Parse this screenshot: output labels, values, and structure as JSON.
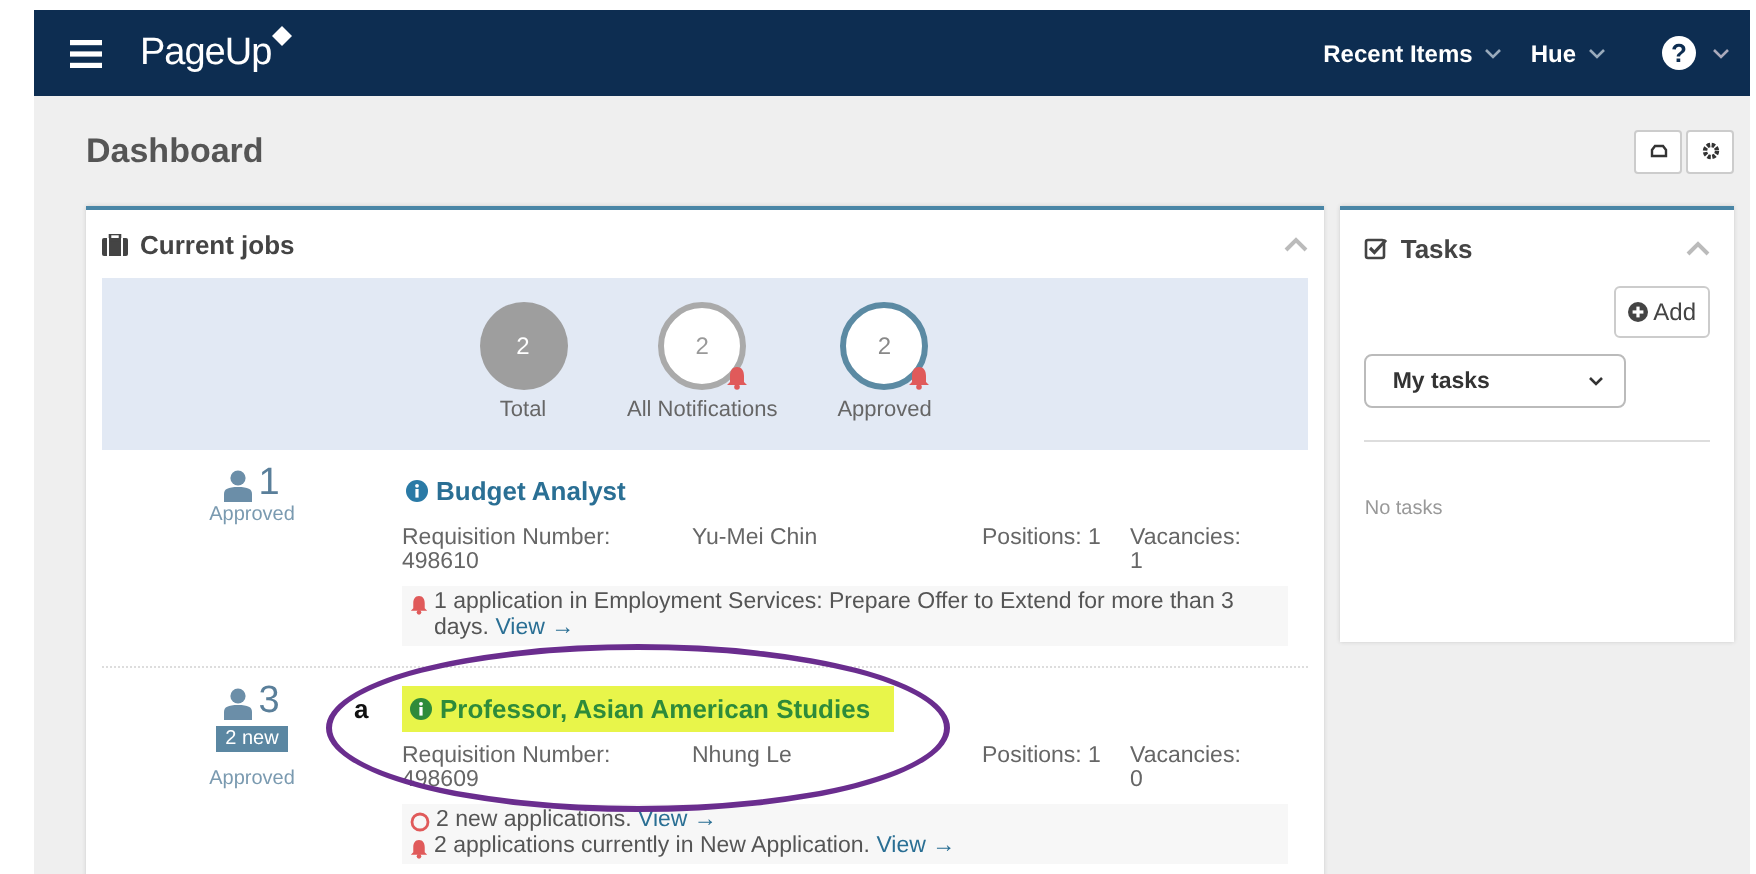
{
  "navbar": {
    "logo": "PageUp",
    "menus": [
      {
        "label": "Recent Items"
      },
      {
        "label": "Hue"
      }
    ],
    "help": "?"
  },
  "page_title": "Dashboard",
  "current_jobs": {
    "title": "Current jobs",
    "summary": [
      {
        "kind": "filled",
        "count": "2",
        "label": "Total",
        "alert": false
      },
      {
        "kind": "ring",
        "count": "2",
        "label": "All Notifications",
        "alert": true
      },
      {
        "kind": "ring-blue",
        "count": "2",
        "label": "Approved",
        "alert": true
      }
    ],
    "jobs": [
      {
        "count": "1",
        "status": "Approved",
        "title": "Budget Analyst",
        "highlighted": false,
        "requisition_label": "Requisition Number:",
        "requisition": "498610",
        "manager": "Yu-Mei Chin",
        "positions": "Positions: 1",
        "vacancies_label": "Vacancies:",
        "vacancies": "1",
        "notices": [
          {
            "kind": "bell",
            "text": "1 application in Employment Services: Prepare Offer to Extend for more than 3 days.",
            "link": "View →"
          }
        ]
      },
      {
        "count": "3",
        "new_badge": "2 new",
        "status": "Approved",
        "title": "Professor, Asian American Studies",
        "highlighted": true,
        "annotation": "a",
        "requisition_label": "Requisition Number:",
        "requisition": "498609",
        "manager": "Nhung Le",
        "positions": "Positions: 1",
        "vacancies_label": "Vacancies:",
        "vacancies": "0",
        "notices": [
          {
            "kind": "circle",
            "text": "2 new applications.",
            "link": "View →"
          },
          {
            "kind": "bell",
            "text": "2 applications currently in New Application.",
            "link": "View →"
          }
        ]
      }
    ]
  },
  "tasks": {
    "title": "Tasks",
    "add_button": "Add",
    "filter": "My tasks",
    "empty": "No tasks"
  }
}
